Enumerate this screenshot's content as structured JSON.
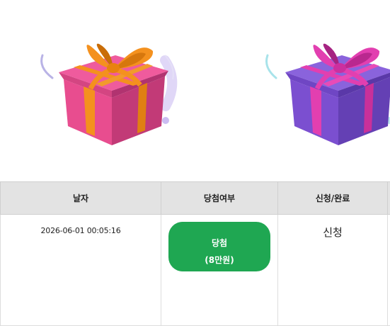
{
  "gifts": [
    {
      "name": "pink-gift",
      "box_color": "#e84d8f",
      "ribbon_color": "#f4911e"
    },
    {
      "name": "purple-gift",
      "box_color": "#7b4fd0",
      "ribbon_color": "#e23fb0"
    }
  ],
  "table": {
    "headers": {
      "date": "날자",
      "result": "당첨여부",
      "status": "신청/완료"
    },
    "rows": [
      {
        "date": "2026-06-01 00:05:16",
        "result_title": "당첨",
        "result_amount": "(8만원)",
        "status": "신청"
      }
    ]
  },
  "colors": {
    "win_button": "#1fa752",
    "header_bg": "#e3e3e3"
  }
}
